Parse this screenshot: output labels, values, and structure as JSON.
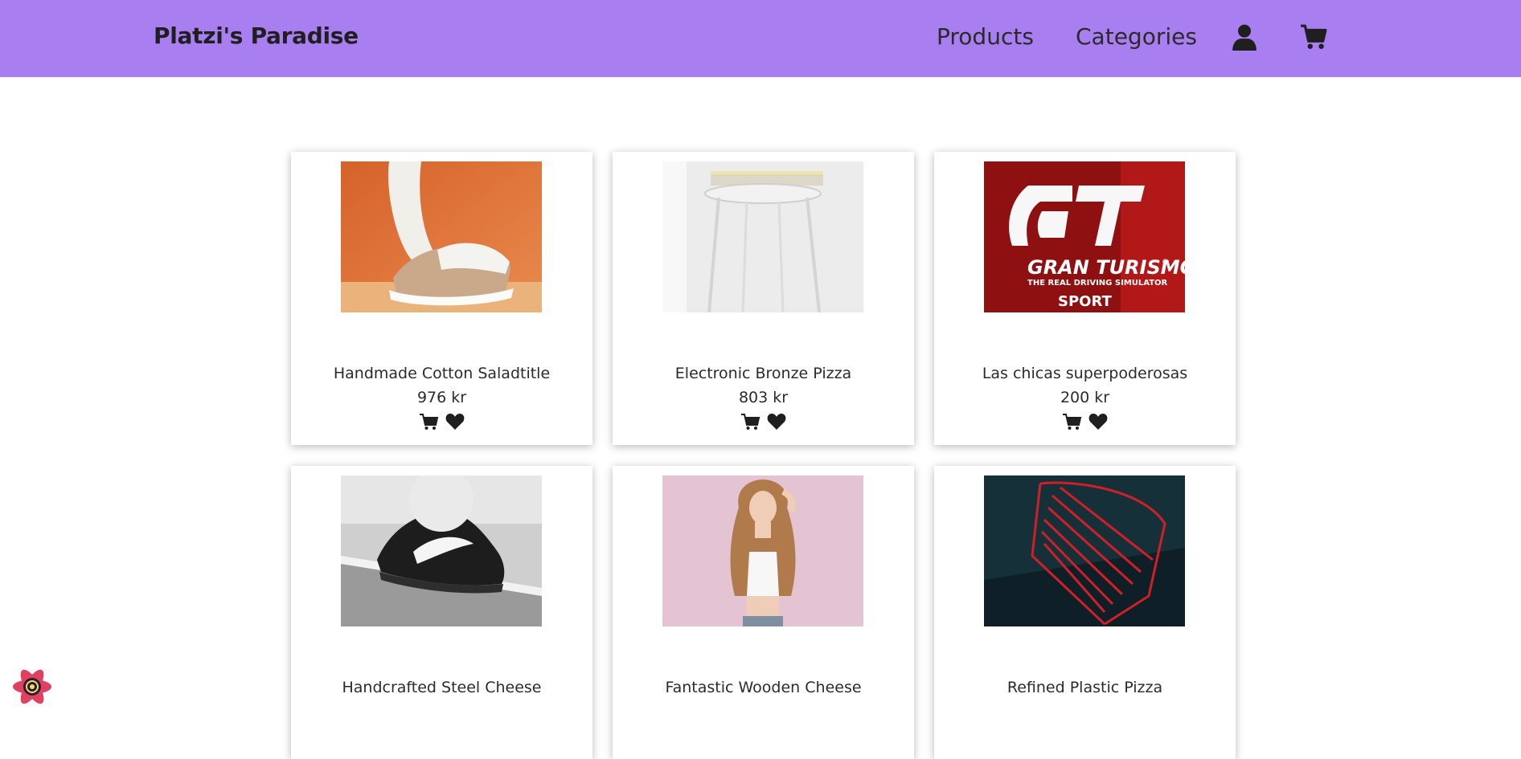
{
  "navbar": {
    "brand": "Platzi's Paradise",
    "links": [
      "Products",
      "Categories"
    ],
    "icons": [
      "user-icon",
      "cart-icon"
    ],
    "background": "#a97ef1"
  },
  "products": [
    {
      "title": "Handmade Cotton Saladtitle",
      "price": "976 kr",
      "image": "sneaker-orange"
    },
    {
      "title": "Electronic Bronze Pizza",
      "price": "803 kr",
      "image": "white-stool"
    },
    {
      "title": "Las chicas superpoderosas",
      "price": "200 kr",
      "image": "gran-turismo-cover"
    },
    {
      "title": "Handcrafted Steel Cheese",
      "image": "black-sneaker"
    },
    {
      "title": "Fantastic Wooden Cheese",
      "image": "woman-pink"
    },
    {
      "title": "Refined Plastic Pizza",
      "image": "red-chair"
    }
  ],
  "card_actions": [
    "cart-icon",
    "heart-icon"
  ],
  "gran_turismo_cover": {
    "title": "GRAN TURISMO",
    "registered": "®",
    "subtitle": "THE REAL DRIVING SIMULATOR",
    "edition": "SPORT"
  },
  "react_badge": "react-devtools-icon"
}
